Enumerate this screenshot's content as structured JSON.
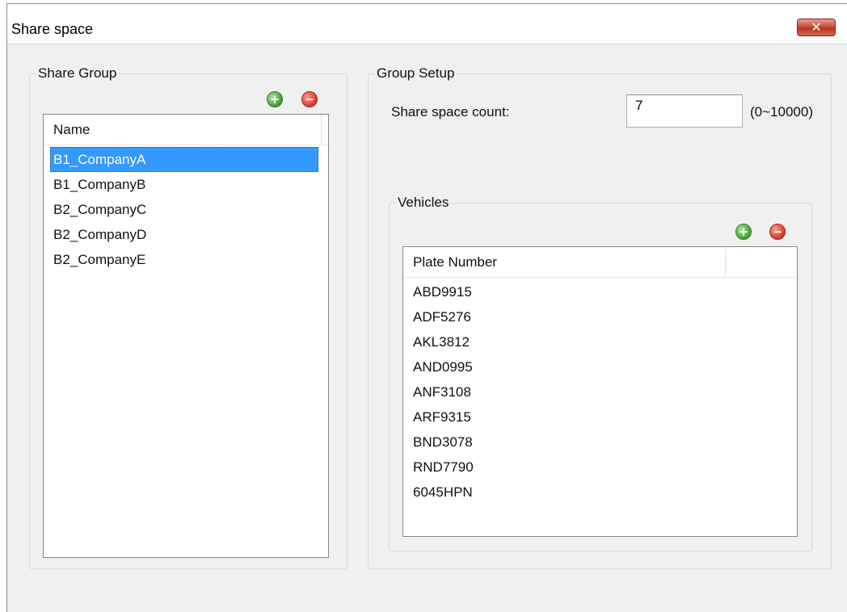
{
  "window": {
    "title": "Share space",
    "close_symbol": "✕"
  },
  "share_group": {
    "legend": "Share Group",
    "add_icon": "+",
    "remove_icon": "−",
    "columns": [
      "Name"
    ],
    "rows": [
      "B1_CompanyA",
      "B1_CompanyB",
      "B2_CompanyC",
      "B2_CompanyD",
      "B2_CompanyE"
    ],
    "selected_index": 0
  },
  "group_setup": {
    "legend": "Group Setup",
    "count_label": "Share space count:",
    "count_value": "7",
    "count_range": "(0~10000)",
    "vehicles": {
      "legend": "Vehicles",
      "add_icon": "+",
      "remove_icon": "−",
      "columns": [
        "Plate Number"
      ],
      "rows": [
        "ABD9915",
        "ADF5276",
        "AKL3812",
        "AND0995",
        "ANF3108",
        "ARF9315",
        "BND3078",
        "RND7790",
        "6045HPN"
      ]
    }
  },
  "colors": {
    "selection": "#3399ff",
    "window_bg": "#f0f0f0",
    "close_button": "#c8472e",
    "add_button": "#3e9f2c",
    "remove_button": "#d8362a"
  }
}
